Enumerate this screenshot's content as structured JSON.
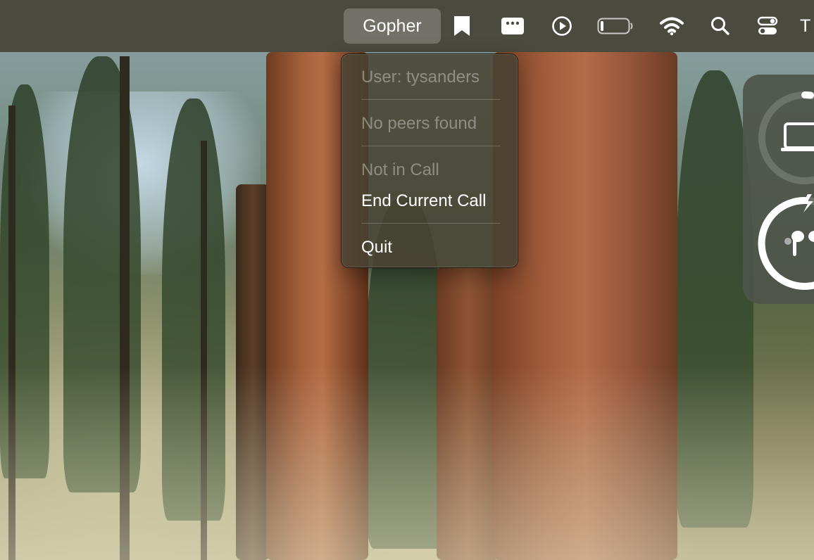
{
  "menubar": {
    "app_label": "Gopher",
    "icons": [
      "bookmark-icon",
      "display-icon",
      "play-icon",
      "battery-icon",
      "wifi-icon",
      "search-icon",
      "control-center-icon"
    ],
    "clock_partial": "T"
  },
  "menu": {
    "user": "User: tysanders",
    "peers": "No peers found",
    "call_status": "Not in Call",
    "end_call": "End Current Call",
    "quit": "Quit"
  },
  "widget": {
    "devices": [
      "laptop-icon",
      "airpods-icon"
    ],
    "colors": {
      "ring_track": "#6c736a",
      "ring_fill": "#ffffff"
    }
  }
}
